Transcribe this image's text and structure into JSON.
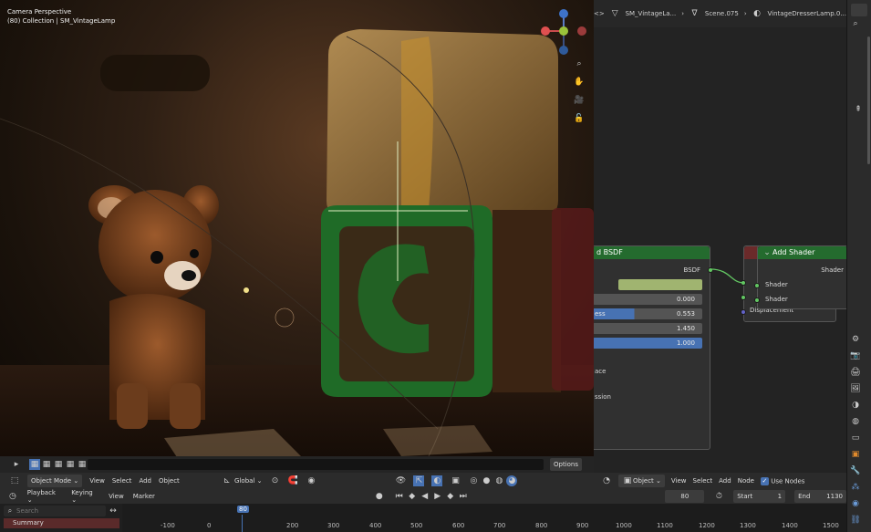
{
  "viewport": {
    "title": "Camera Perspective",
    "subtitle": "(80) Collection | SM_VintageLamp",
    "options_label": "Options",
    "gizmo": {
      "x": "X",
      "y": "Y",
      "z": "Z"
    }
  },
  "viewport_header": {
    "mode": "Object Mode",
    "menus": [
      "View",
      "Select",
      "Add",
      "Object"
    ],
    "transform_orientation": "Global"
  },
  "node_editor": {
    "breadcrumb": [
      "SM_VintageLa...",
      "Scene.075",
      "VintageDresserLamp.0..."
    ],
    "bsdf_node": {
      "title": "d BSDF",
      "output": "BSDF",
      "fields": [
        {
          "label": "",
          "value": "0.000"
        },
        {
          "label": "ess",
          "value": "0.553"
        },
        {
          "label": "",
          "value": "1.450"
        },
        {
          "label": "",
          "value": "1.000"
        }
      ],
      "labels": [
        "ace",
        "ssion"
      ]
    },
    "add_shader_node": {
      "title": "Add Shader",
      "output": "Shader",
      "inputs": [
        "Shader",
        "Shader"
      ]
    },
    "hidden_node_label": "Displacement",
    "header": {
      "object_label": "Object",
      "menus": [
        "View",
        "Select",
        "Add",
        "Node"
      ],
      "use_nodes_label": "Use Nodes"
    }
  },
  "timeline": {
    "menus": [
      "Playback",
      "Keying",
      "View",
      "Marker"
    ],
    "current_frame": "80",
    "start_label": "Start",
    "start_value": "1",
    "end_label": "End",
    "end_value": "1130",
    "search_placeholder": "Search",
    "summary_label": "Summary",
    "ticks": [
      "-100",
      "0",
      "80",
      "200",
      "300",
      "400",
      "500",
      "600",
      "700",
      "800",
      "900",
      "1000",
      "1100",
      "1200",
      "1300",
      "1400",
      "1500"
    ]
  },
  "colors": {
    "accent_blue": "#4772b3",
    "node_green": "#246b2e",
    "socket_green": "#63c763",
    "socket_purple": "#6363c7",
    "frame_marker": "#4772b3"
  }
}
